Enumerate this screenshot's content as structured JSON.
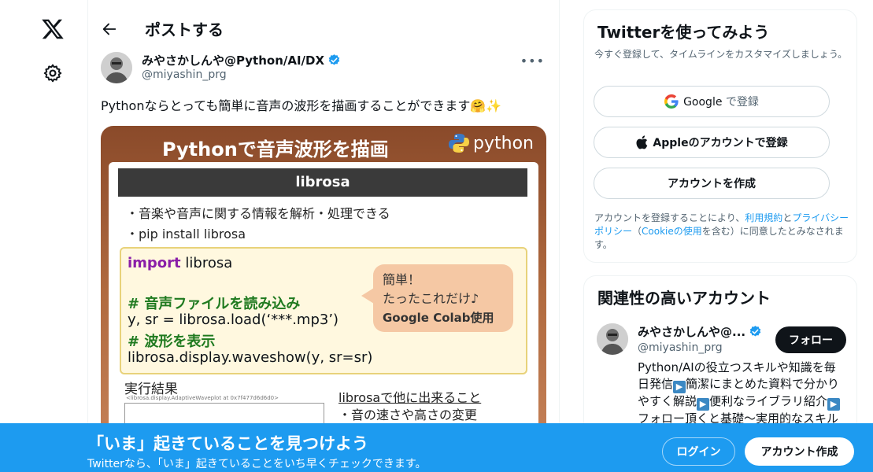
{
  "main": {
    "title": "ポストする",
    "author": {
      "name": "みやさかしんや@Python/AI/DX",
      "handle": "@miyashin_prg"
    },
    "post_text": "Pythonならとっても簡単に音声の波形を描画することができます🤗✨",
    "image": {
      "title": "Pythonで音声波形を描画",
      "python_word": "python",
      "header": "librosa",
      "bullets": [
        "・音楽や音声に関する情報を解析・処理できる",
        "・pip install librosa"
      ],
      "code": {
        "import_kw": "import",
        "import_rest": " librosa",
        "comment1": "# 音声ファイルを読み込み",
        "line2": "y, sr = librosa.load(‘***.mp3’)",
        "comment2": "# 波形を表示",
        "line3": "librosa.display.waveshow(y, sr=sr)"
      },
      "bubble": [
        "簡単！",
        "たったこれだけ♪",
        "Google Colab使用"
      ],
      "result_title": "実行結果",
      "result_small": "<librosa.display.AdaptiveWaveplot at 0x7f477d6d6d0>",
      "other_title": "librosaで他に出来ること",
      "other_item": "・音の速さや高さの変更"
    }
  },
  "sidebar": {
    "card1": {
      "title": "Twitterを使ってみよう",
      "subtitle": "今すぐ登録して、タイムラインをカスタマイズしましょう。",
      "google_prefix": "Google",
      "google_suffix": " で登録",
      "apple_label": "Appleのアカウントで登録",
      "create_label": "アカウントを作成",
      "terms_1": "アカウントを登録することにより、",
      "terms_link1": "利用規約",
      "terms_2": "と",
      "terms_link2": "プライバシーポリシー",
      "terms_3": "（",
      "terms_link3": "Cookieの使用",
      "terms_4": "を含む）に同意したとみなされます。"
    },
    "card2": {
      "title": "関連性の高いアカウント",
      "name": "みやさかしんや@...",
      "handle": "@miyashin_prg",
      "follow_label": "フォロー",
      "bio_1": "Python/AIの役立つスキルや知識を毎日発信",
      "bio_2": "簡潔にまとめた資料で分かりやすく解説",
      "bio_3": "便利なライブラリ紹介",
      "bio_4": "フォロー頂くと基礎〜実用的なスキル"
    }
  },
  "banner": {
    "title": "「いま」起きていることを見つけよう",
    "subtitle": "Twitterなら、「いま」起きていることをいち早くチェックできます。",
    "login_label": "ログイン",
    "signup_label": "アカウント作成"
  },
  "colors": {
    "accent": "#1d9bf0",
    "text": "#0f1419",
    "muted": "#536471"
  },
  "icons": [
    "x-logo-icon",
    "gear-icon",
    "back-arrow-icon",
    "verified-badge-icon",
    "more-icon",
    "google-icon",
    "apple-icon",
    "python-logo-icon"
  ]
}
